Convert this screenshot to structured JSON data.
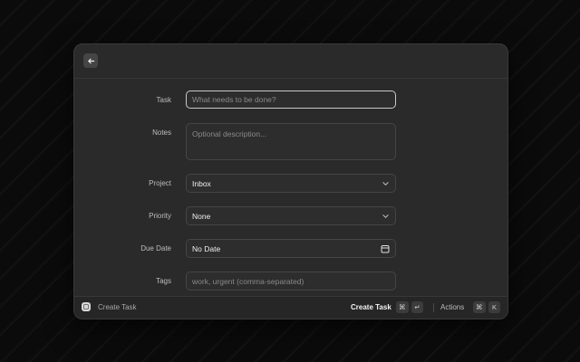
{
  "form": {
    "task": {
      "label": "Task",
      "placeholder": "What needs to be done?"
    },
    "notes": {
      "label": "Notes",
      "placeholder": "Optional description..."
    },
    "project": {
      "label": "Project",
      "value": "Inbox"
    },
    "priority": {
      "label": "Priority",
      "value": "None"
    },
    "due_date": {
      "label": "Due Date",
      "value": "No Date"
    },
    "tags": {
      "label": "Tags",
      "placeholder": "work, urgent (comma-separated)"
    }
  },
  "footer": {
    "title": "Create Task",
    "primary_action": "Create Task",
    "primary_key_1": "⌘",
    "primary_key_2": "↵",
    "actions_label": "Actions",
    "actions_key_1": "⌘",
    "actions_key_2": "K"
  },
  "icons": {
    "back": "back-arrow-icon",
    "chevron": "chevron-down-icon",
    "calendar": "calendar-icon",
    "app": "app-icon"
  },
  "colors": {
    "background": "#0b0b0b",
    "window": "#2a2a2a",
    "focus_border": "#c9c9c9"
  }
}
